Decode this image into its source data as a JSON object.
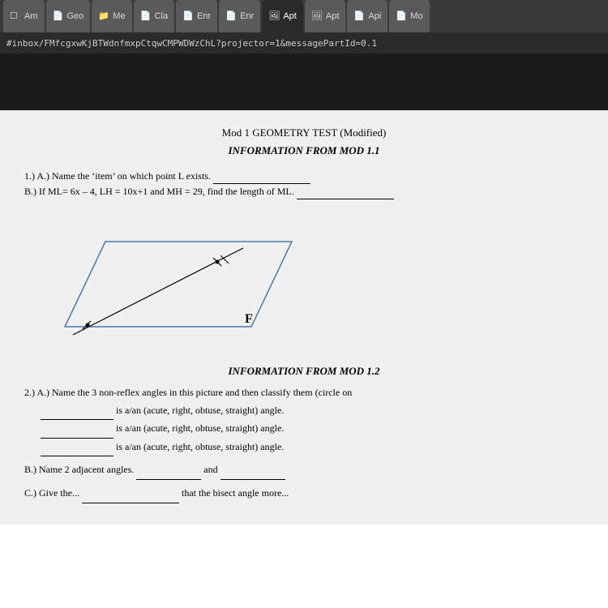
{
  "tabs": [
    {
      "label": "Am",
      "icon": "page",
      "active": false
    },
    {
      "label": "Geo",
      "icon": "doc",
      "active": false
    },
    {
      "label": "Me",
      "icon": "folder",
      "active": false
    },
    {
      "label": "Cla",
      "icon": "doc",
      "active": false
    },
    {
      "label": "Enr",
      "icon": "doc",
      "active": false
    },
    {
      "label": "Enr",
      "icon": "doc",
      "active": false
    },
    {
      "label": "Apt",
      "icon": "image",
      "active": true
    },
    {
      "label": "Apt",
      "icon": "image",
      "active": false
    },
    {
      "label": "Api",
      "icon": "doc",
      "active": false
    },
    {
      "label": "Mo",
      "icon": "doc",
      "active": false
    }
  ],
  "address_bar": {
    "url": "#inbox/FMfcgxwKjBTWdnfmxpCtqwCMPWDWzChL?projector=1&messagePartId=0.1"
  },
  "document": {
    "title": "Mod 1 GEOMETRY TEST (Modified)",
    "section1_heading": "INFORMATION FROM MOD 1.1",
    "q1_a": "1.)  A.)  Name the ‘item’ on which point L exists.",
    "q1_b": "       B.)  If ML= 6x – 4, LH = 10x+1 and MH = 29, find the length of ML.",
    "diagram_label": "F",
    "section2_heading": "INFORMATION FROM MOD 1.2",
    "q2_intro": "2.)  A.)  Name the 3 non-reflex angles in this picture and then classify them (circle on",
    "q2_line1": " is a/an (acute, right, obtuse, straight) angle.",
    "q2_line2": " is a/an (acute, right, obtuse, straight) angle.",
    "q2_line3": " is a/an (acute, right, obtuse, straight) angle.",
    "q2_b": "B.)  Name 2 adjacent angles.",
    "q2_b_and": "and",
    "q2_c_partial": "C.)  Give the..."
  }
}
